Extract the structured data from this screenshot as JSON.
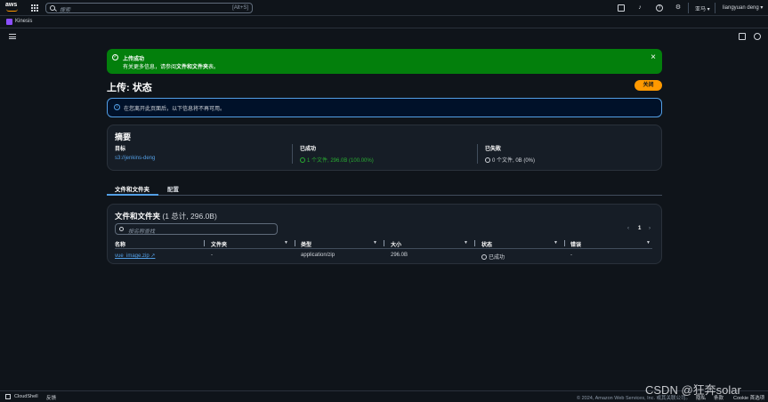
{
  "nav": {
    "logo_text": "aws",
    "search_placeholder": "搜索",
    "search_shortcut": "[Alt+S]",
    "region": "亚马",
    "user": "liangyuan deng"
  },
  "service": {
    "name": "Kinesis"
  },
  "flash": {
    "title": "上传成功",
    "message_prefix": "有关更多信息，请参阅",
    "message_bold": "文件和文件夹",
    "message_suffix": "表。"
  },
  "header": {
    "title": "上传: 状态",
    "close_label": "关闭"
  },
  "info": {
    "text": "在您离开此页面后，以下信息将不再可用。"
  },
  "summary": {
    "heading": "摘要",
    "destination_label": "目标",
    "destination_value": "s3://jenkins-deng",
    "succeeded_label": "已成功",
    "succeeded_value": "1 个文件, 296.0B (100.00%)",
    "failed_label": "已失败",
    "failed_value": "0 个文件, 0B (0%)"
  },
  "tabs": [
    {
      "label": "文件和文件夹"
    },
    {
      "label": "配置"
    }
  ],
  "files": {
    "heading": "文件和文件夹",
    "count": "(1 总计, 296.0B)",
    "search_placeholder": "按名称查找",
    "page": "1",
    "columns": [
      "名称",
      "文件夹",
      "类型",
      "大小",
      "状态",
      "错误"
    ],
    "rows": [
      {
        "name": "vue_image.zip",
        "folder": "-",
        "type": "application/zip",
        "size": "296.0B",
        "status": "已成功",
        "error": "-"
      }
    ]
  },
  "footer": {
    "cloudshell": "CloudShell",
    "feedback": "反馈",
    "copyright": "© 2024, Amazon Web Services, Inc. 或其关联公司。",
    "privacy": "隐私",
    "terms": "条款",
    "cookie": "Cookie 首选项"
  },
  "watermark": "CSDN @狂奔solar"
}
